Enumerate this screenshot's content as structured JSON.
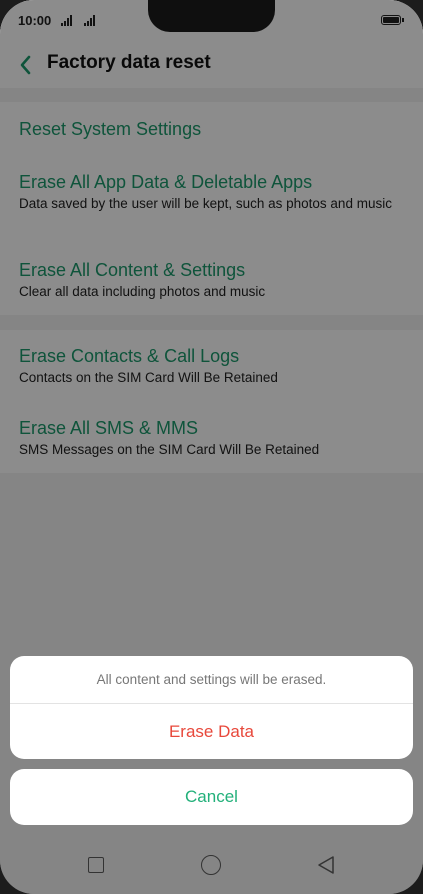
{
  "status_bar": {
    "time": "10:00"
  },
  "header": {
    "title": "Factory data reset"
  },
  "groups": [
    {
      "items": [
        {
          "title": "Reset System Settings",
          "subtitle": ""
        },
        {
          "title": "Erase All App Data & Deletable Apps",
          "subtitle": "Data saved by the user will be kept, such as photos and music"
        },
        {
          "title": "Erase All Content & Settings",
          "subtitle": "Clear all data including photos and music"
        }
      ]
    },
    {
      "items": [
        {
          "title": "Erase Contacts & Call Logs",
          "subtitle": "Contacts on the SIM Card Will Be Retained"
        },
        {
          "title": "Erase All SMS & MMS",
          "subtitle": "SMS Messages on the SIM Card Will Be Retained"
        }
      ]
    }
  ],
  "dialog": {
    "message": "All content and settings will be erased.",
    "confirm_label": "Erase Data",
    "cancel_label": "Cancel"
  },
  "colors": {
    "accent": "#1c9a6c",
    "danger": "#e8483b",
    "cancel": "#22b07a"
  },
  "nav_icons": [
    "recent-apps-icon",
    "home-icon",
    "back-icon"
  ]
}
